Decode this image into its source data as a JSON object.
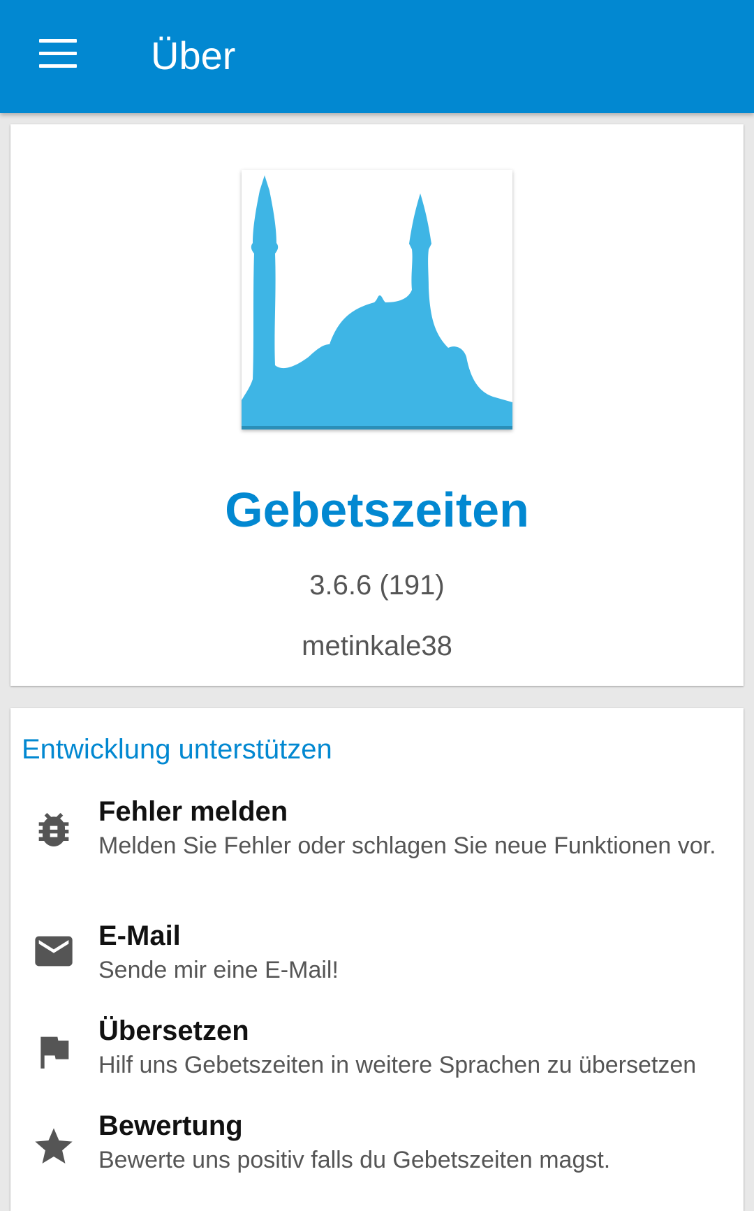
{
  "appbar": {
    "title": "Über",
    "menu_icon": "menu-icon",
    "color": "#0288d1"
  },
  "about": {
    "logo": "mosque-logo",
    "app_name": "Gebetszeiten",
    "version": "3.6.6 (191)",
    "author": "metinkale38"
  },
  "support": {
    "title": "Entwicklung unterstützen",
    "items": [
      {
        "icon": "bug-icon",
        "title": "Fehler melden",
        "description": "Melden Sie Fehler oder schlagen Sie neue Funktionen vor."
      },
      {
        "icon": "mail-icon",
        "title": "E-Mail",
        "description": "Sende mir eine E-Mail!"
      },
      {
        "icon": "flag-icon",
        "title": "Übersetzen",
        "description": "Hilf uns Gebetszeiten in weitere Sprachen zu übersetzen"
      },
      {
        "icon": "star-icon",
        "title": "Bewertung",
        "description": "Bewerte uns positiv falls du Gebetszeiten magst."
      }
    ]
  },
  "colors": {
    "accent": "#0288d1",
    "logo_blue": "#3eb5e5",
    "icon_gray": "#555555"
  }
}
